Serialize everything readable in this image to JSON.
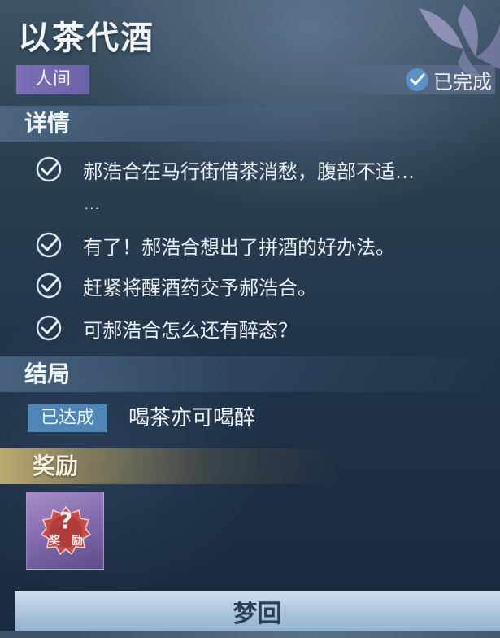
{
  "header": {
    "title": "以茶代酒",
    "realm_tag": "人间",
    "status": "已完成"
  },
  "details": {
    "heading": "详情",
    "tasks": [
      {
        "text": "郝浩合在马行街借茶消愁，腹部不适…"
      },
      {
        "text": "有了！郝浩合想出了拼酒的好办法。"
      },
      {
        "text": "赶紧将醒酒药交予郝浩合。"
      },
      {
        "text": "可郝浩合怎么还有醉态？"
      }
    ],
    "continuation": "…"
  },
  "ending": {
    "heading": "结局",
    "badge": "已达成",
    "text": "喝茶亦可喝醉"
  },
  "reward": {
    "heading": "奖励",
    "item_char_1": "奖",
    "item_char_2": "励"
  },
  "footer": {
    "button_label": "梦回"
  },
  "colors": {
    "realm_tag": "#7d6fb8",
    "ending_badge": "#4f86b8",
    "reward_band": "#d6be78",
    "button": "#a9c3dc"
  },
  "icons": [
    "petal-emblem-icon",
    "check-circle-icon",
    "reward-mystery-icon"
  ]
}
